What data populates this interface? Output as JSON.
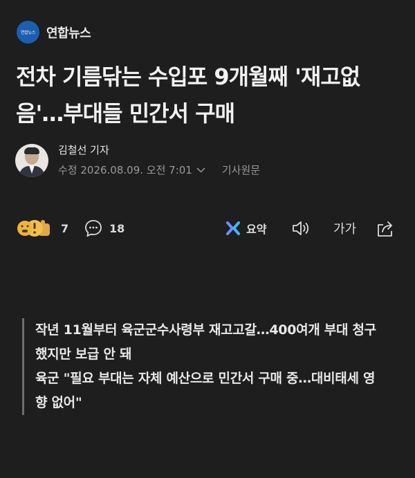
{
  "press": {
    "logo_text": "연합뉴스",
    "name": "연합뉴스",
    "brand_color": "#1c5fb2"
  },
  "headline": "전차 기름닦는 수입포 9개월째 '재고없음'…부대들 민간서 구매",
  "byline": {
    "reporter": "김철선 기자",
    "date_label": "수정 2026.08.09. 오전 7:01",
    "original_link": "기사원문"
  },
  "toolbar": {
    "reaction_count": "7",
    "comment_count": "18",
    "summary_label": "요약",
    "font_label": "가가"
  },
  "summary_lines": [
    "작년 11월부터 육군군수사령부 재고고갈…400여개 부대 청구했지만 보급 안 돼",
    "육군 \"필요 부대는 자체 예산으로 민간서 구매 중…대비태세 영향 없어\""
  ]
}
